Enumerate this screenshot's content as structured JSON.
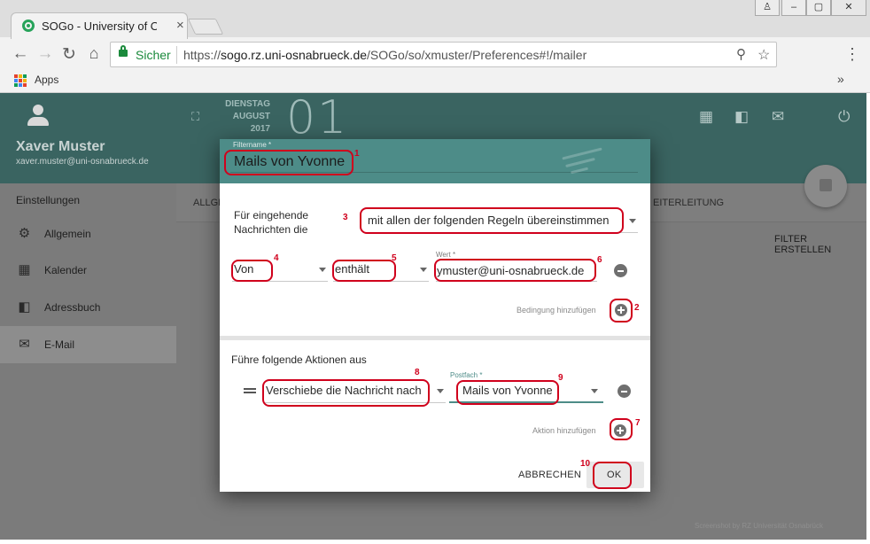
{
  "browser": {
    "tab_title": "SOGo - University of Osnabrück",
    "tab_close": "×",
    "secure_label": "Sicher",
    "url_scheme": "https://",
    "url_host": "sogo.rz.uni-osnabrueck.de",
    "url_path": "/SOGo/so/xmuster/Preferences#!/mailer",
    "bookmarks_apps": "Apps",
    "bookmarks_more": "»",
    "window_buttons": [
      "♙",
      "–",
      "▢",
      "✕"
    ]
  },
  "user": {
    "name": "Xaver Muster",
    "email": "xaver.muster@uni-osnabrueck.de"
  },
  "sidebar": {
    "heading": "Einstellungen",
    "items": [
      {
        "label": "Allgemein",
        "icon": "gear-icon"
      },
      {
        "label": "Kalender",
        "icon": "calendar-icon"
      },
      {
        "label": "Adressbuch",
        "icon": "contacts-icon"
      },
      {
        "label": "E-Mail",
        "icon": "mail-icon",
        "active": true
      }
    ]
  },
  "header": {
    "weekday": "DIENSTAG",
    "month": "AUGUST",
    "year": "2017",
    "day": "01"
  },
  "content": {
    "tab_left_partial": "ALLGE",
    "tab_right_partial": "EITERLEITUNG",
    "filter_create": "FILTER ERSTELLEN",
    "credit": "Screenshot by RZ Universität Osnabrück"
  },
  "dialog": {
    "filtername_label": "Filtername *",
    "filtername_value": "Mails von Yvonne",
    "incoming_label_line1": "Für eingehende",
    "incoming_label_line2": "Nachrichten die",
    "match_select": "mit allen der folgenden Regeln übereinstimmen",
    "condition": {
      "field": "Von",
      "operator": "enthält",
      "value_label": "Wert *",
      "value": "ymuster@uni-osnabrueck.de"
    },
    "add_condition": "Bedingung hinzufügen",
    "actions_heading": "Führe folgende Aktionen aus",
    "action": {
      "type": "Verschiebe die Nachricht nach",
      "folder_label": "Postfach *",
      "folder": "Mails von Yvonne"
    },
    "add_action": "Aktion hinzufügen",
    "cancel": "ABBRECHEN",
    "ok": "OK"
  },
  "annotations": [
    "1",
    "2",
    "3",
    "4",
    "5",
    "6",
    "7",
    "8",
    "9",
    "10"
  ],
  "colors": {
    "accent_teal": "#4d8c88",
    "header_dark_teal": "#3a6461",
    "annotation_red": "#d0001c",
    "secure_green": "#1b8a3c"
  }
}
